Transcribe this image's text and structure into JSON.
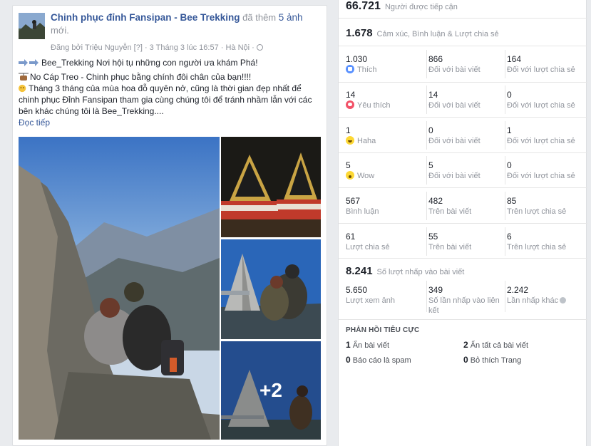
{
  "post": {
    "page_name": "Chinh phục đỉnh Fansipan - Bee Trekking",
    "action": "đã thêm",
    "photo_count": "5 ảnh",
    "action_tail": "mới.",
    "meta": "Đăng bởi Triệu Nguyễn [?] · 3 Tháng 3 lúc 16:57 · Hà Nội ·",
    "line1": "Bee_Trekking Nơi hội tụ những con người ưa khám Phá!",
    "line2": "No Cáp Treo - Chinh phục bằng chính đôi chân của bạn!!!!",
    "line3": "Tháng 3 tháng của mùa hoa đỗ quyên nở, cũng là thời gian đẹp nhất để chinh phục Đỉnh Fansipan tham gia cùng chúng tôi để tránh nhầm lẫn với các bên khác chúng tôi là Bee_Trekking....",
    "read_more": "Đọc tiếp",
    "more_photos": "+2"
  },
  "insights": {
    "reach_value": "66.721",
    "reach_label": "Người được tiếp cận",
    "engagement_value": "1.678",
    "engagement_label": "Cảm xúc, Bình luận & Lượt chia sẻ",
    "rows": [
      {
        "icon": "like-icon",
        "total": "1.030",
        "label": "Thích",
        "on_post": "866",
        "on_post_label": "Đối với bài viết",
        "on_shares": "164",
        "on_shares_label": "Đối với lượt chia sẻ"
      },
      {
        "icon": "love-icon",
        "total": "14",
        "label": "Yêu thích",
        "on_post": "14",
        "on_post_label": "Đối với bài viết",
        "on_shares": "0",
        "on_shares_label": "Đối với lượt chia sẻ"
      },
      {
        "icon": "haha-icon",
        "total": "1",
        "label": "Haha",
        "on_post": "0",
        "on_post_label": "Đối với bài viết",
        "on_shares": "1",
        "on_shares_label": "Đối với lượt chia sẻ"
      },
      {
        "icon": "wow-icon",
        "total": "5",
        "label": "Wow",
        "on_post": "5",
        "on_post_label": "Đối với bài viết",
        "on_shares": "0",
        "on_shares_label": "Đối với lượt chia sẻ"
      },
      {
        "icon": "",
        "total": "567",
        "label": "Bình luận",
        "on_post": "482",
        "on_post_label": "Trên bài viết",
        "on_shares": "85",
        "on_shares_label": "Trên lượt chia sẻ"
      },
      {
        "icon": "",
        "total": "61",
        "label": "Lượt chia sẻ",
        "on_post": "55",
        "on_post_label": "Trên bài viết",
        "on_shares": "6",
        "on_shares_label": "Trên lượt chia sẻ"
      }
    ],
    "post_clicks_value": "8.241",
    "post_clicks_label": "Số lượt nhấp vào bài viết",
    "clicks": [
      {
        "value": "5.650",
        "label": "Lượt xem ảnh"
      },
      {
        "value": "349",
        "label": "Số lần nhấp vào liên kết"
      },
      {
        "value": "2.242",
        "label": "Lần nhấp khác"
      }
    ],
    "negative_title": "PHẢN HỒI TIÊU CỰC",
    "negative": [
      {
        "value": "1",
        "label": "Ẩn bài viết"
      },
      {
        "value": "2",
        "label": "Ẩn tất cả bài viết"
      },
      {
        "value": "0",
        "label": "Báo cáo là spam"
      },
      {
        "value": "0",
        "label": "Bỏ thích Trang"
      }
    ]
  }
}
